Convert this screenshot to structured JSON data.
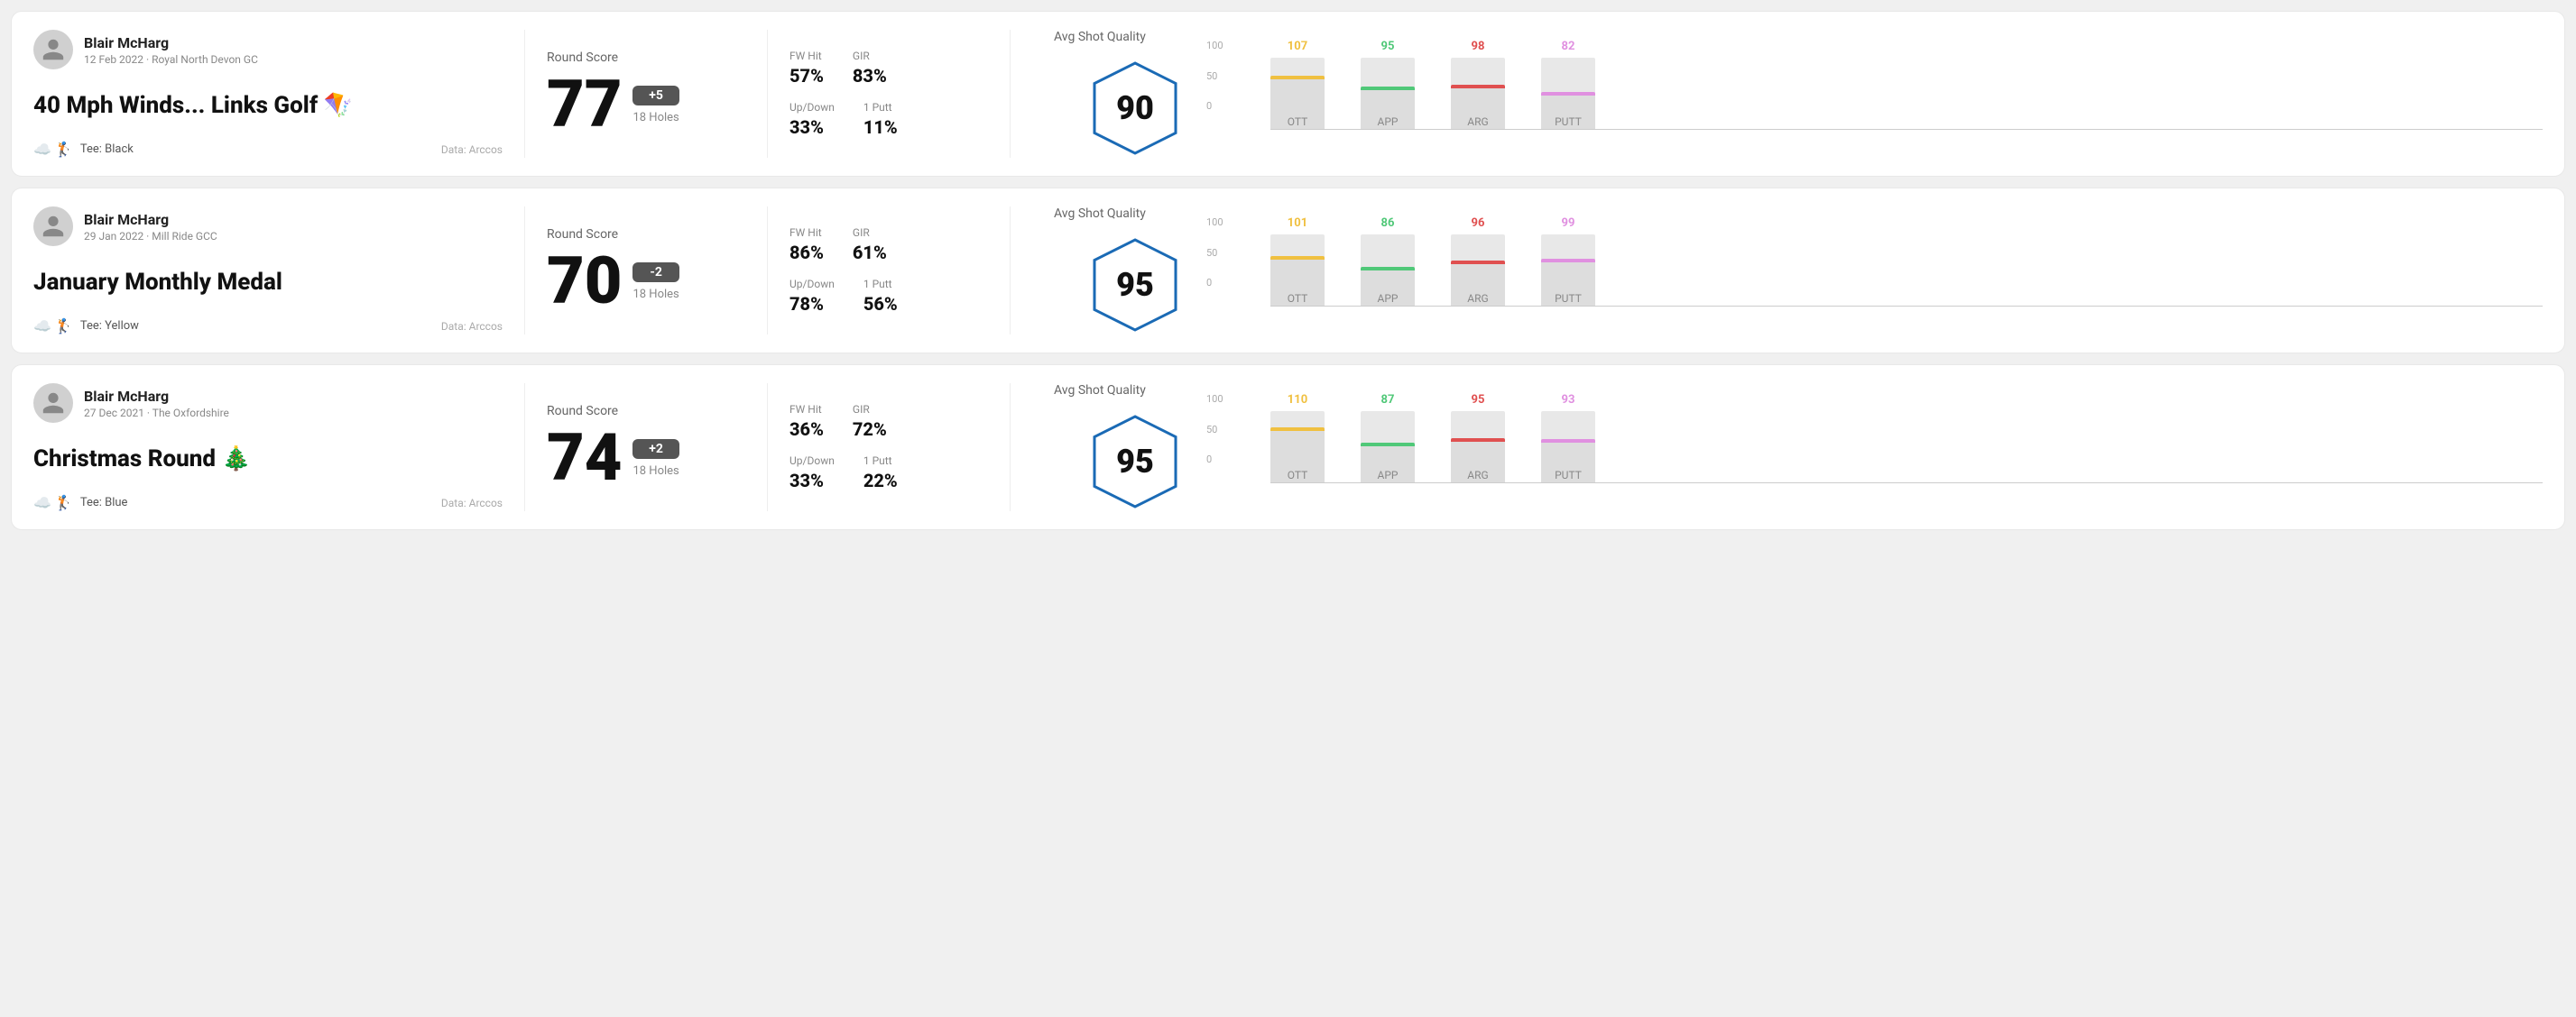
{
  "rounds": [
    {
      "id": "round-1",
      "player": {
        "name": "Blair McHarg",
        "meta": "12 Feb 2022 · Royal North Devon GC"
      },
      "title": "40 Mph Winds... Links Golf 🪁",
      "tee": "Black",
      "dataSource": "Data: Arccos",
      "score": {
        "label": "Round Score",
        "value": "77",
        "modifier": "+5",
        "holes": "18 Holes"
      },
      "stats": {
        "fwHit": {
          "label": "FW Hit",
          "value": "57%"
        },
        "gir": {
          "label": "GIR",
          "value": "83%"
        },
        "upDown": {
          "label": "Up/Down",
          "value": "33%"
        },
        "onePutt": {
          "label": "1 Putt",
          "value": "11%"
        }
      },
      "quality": {
        "label": "Avg Shot Quality",
        "value": "90"
      },
      "chart": {
        "bars": [
          {
            "label": "OTT",
            "topValue": "107",
            "height": 75,
            "color": "#f0c040"
          },
          {
            "label": "APP",
            "topValue": "95",
            "height": 60,
            "color": "#50c878"
          },
          {
            "label": "ARG",
            "topValue": "98",
            "height": 62,
            "color": "#e05050"
          },
          {
            "label": "PUTT",
            "topValue": "82",
            "height": 52,
            "color": "#e090e0"
          }
        ],
        "yLabels": [
          "100",
          "50",
          "0"
        ]
      }
    },
    {
      "id": "round-2",
      "player": {
        "name": "Blair McHarg",
        "meta": "29 Jan 2022 · Mill Ride GCC"
      },
      "title": "January Monthly Medal",
      "tee": "Yellow",
      "dataSource": "Data: Arccos",
      "score": {
        "label": "Round Score",
        "value": "70",
        "modifier": "-2",
        "holes": "18 Holes"
      },
      "stats": {
        "fwHit": {
          "label": "FW Hit",
          "value": "86%"
        },
        "gir": {
          "label": "GIR",
          "value": "61%"
        },
        "upDown": {
          "label": "Up/Down",
          "value": "78%"
        },
        "onePutt": {
          "label": "1 Putt",
          "value": "56%"
        }
      },
      "quality": {
        "label": "Avg Shot Quality",
        "value": "95"
      },
      "chart": {
        "bars": [
          {
            "label": "OTT",
            "topValue": "101",
            "height": 70,
            "color": "#f0c040"
          },
          {
            "label": "APP",
            "topValue": "86",
            "height": 55,
            "color": "#50c878"
          },
          {
            "label": "ARG",
            "topValue": "96",
            "height": 64,
            "color": "#e05050"
          },
          {
            "label": "PUTT",
            "topValue": "99",
            "height": 66,
            "color": "#e090e0"
          }
        ],
        "yLabels": [
          "100",
          "50",
          "0"
        ]
      }
    },
    {
      "id": "round-3",
      "player": {
        "name": "Blair McHarg",
        "meta": "27 Dec 2021 · The Oxfordshire"
      },
      "title": "Christmas Round 🎄",
      "tee": "Blue",
      "dataSource": "Data: Arccos",
      "score": {
        "label": "Round Score",
        "value": "74",
        "modifier": "+2",
        "holes": "18 Holes"
      },
      "stats": {
        "fwHit": {
          "label": "FW Hit",
          "value": "36%"
        },
        "gir": {
          "label": "GIR",
          "value": "72%"
        },
        "upDown": {
          "label": "Up/Down",
          "value": "33%"
        },
        "onePutt": {
          "label": "1 Putt",
          "value": "22%"
        }
      },
      "quality": {
        "label": "Avg Shot Quality",
        "value": "95"
      },
      "chart": {
        "bars": [
          {
            "label": "OTT",
            "topValue": "110",
            "height": 78,
            "color": "#f0c040"
          },
          {
            "label": "APP",
            "topValue": "87",
            "height": 56,
            "color": "#50c878"
          },
          {
            "label": "ARG",
            "topValue": "95",
            "height": 63,
            "color": "#e05050"
          },
          {
            "label": "PUTT",
            "topValue": "93",
            "height": 61,
            "color": "#e090e0"
          }
        ],
        "yLabels": [
          "100",
          "50",
          "0"
        ]
      }
    }
  ]
}
